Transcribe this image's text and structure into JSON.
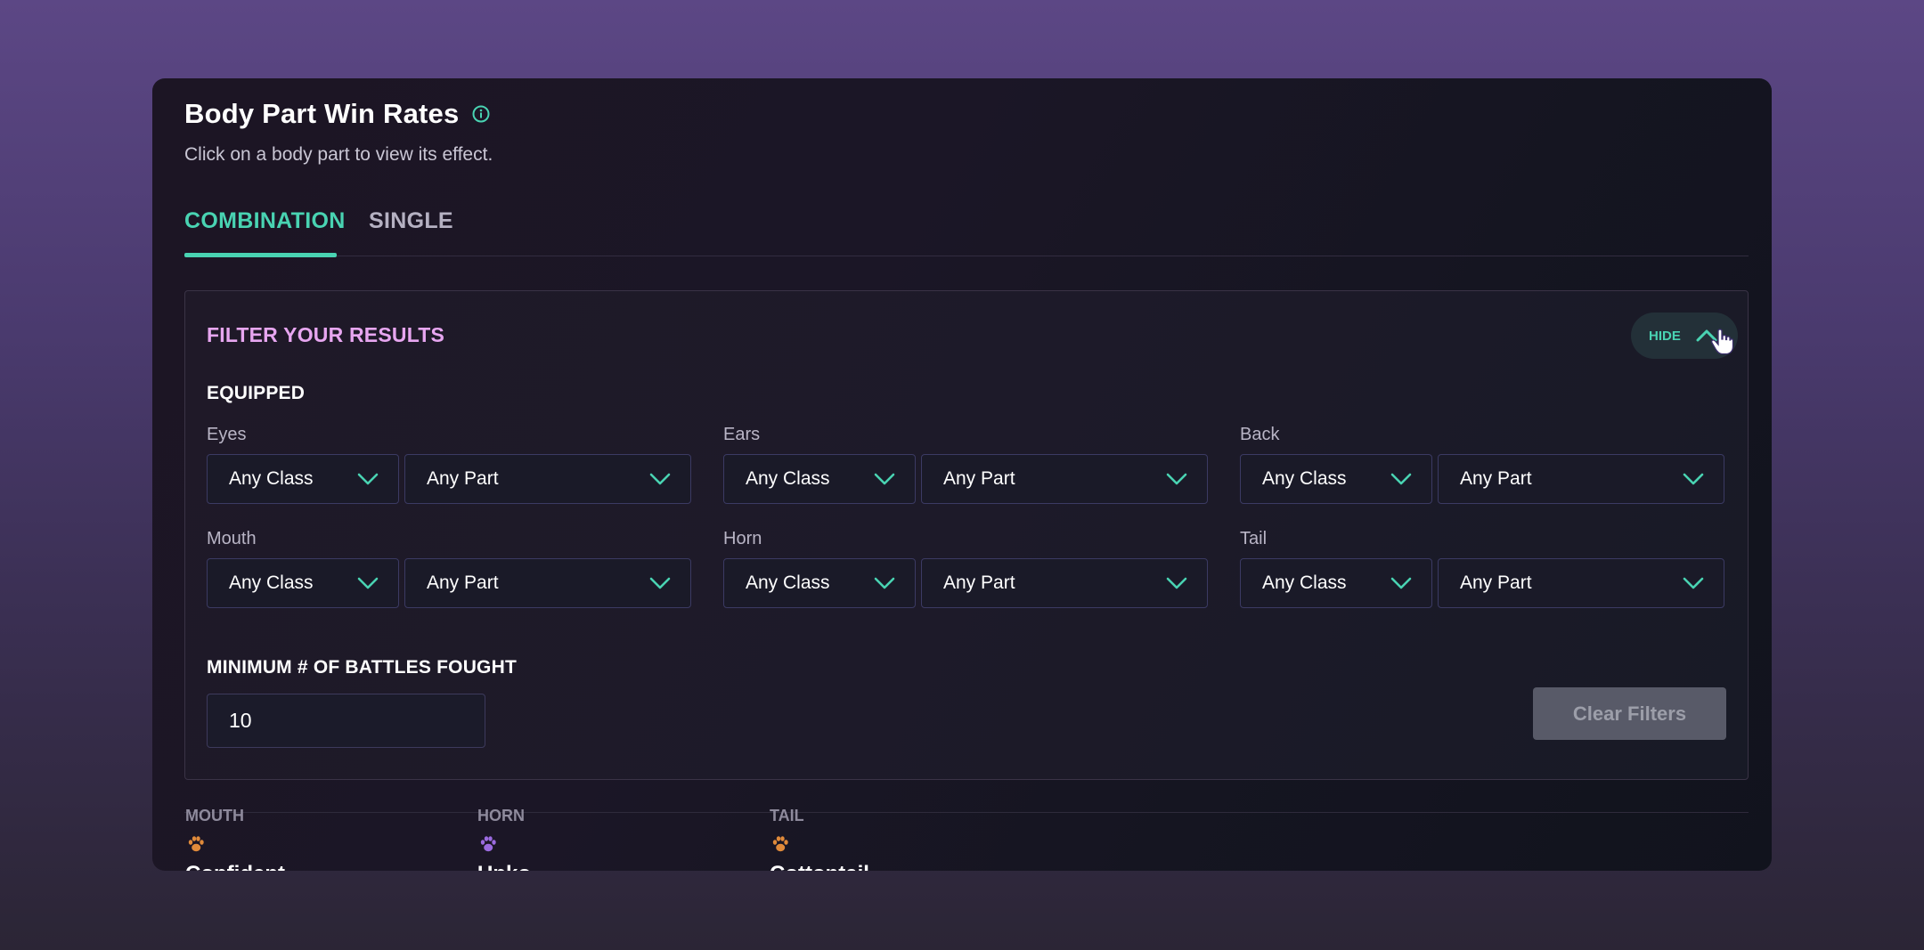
{
  "header": {
    "title": "Body Part Win Rates",
    "subtitle": "Click on a body part to view its effect."
  },
  "tabs": [
    {
      "label": "COMBINATION",
      "active": true
    },
    {
      "label": "SINGLE",
      "active": false
    }
  ],
  "filter": {
    "title": "FILTER YOUR RESULTS",
    "hide_label": "HIDE",
    "equipped_label": "EQUIPPED",
    "parts": [
      {
        "label": "Eyes",
        "class_value": "Any Class",
        "part_value": "Any Part"
      },
      {
        "label": "Ears",
        "class_value": "Any Class",
        "part_value": "Any Part"
      },
      {
        "label": "Back",
        "class_value": "Any Class",
        "part_value": "Any Part"
      },
      {
        "label": "Mouth",
        "class_value": "Any Class",
        "part_value": "Any Part"
      },
      {
        "label": "Horn",
        "class_value": "Any Class",
        "part_value": "Any Part"
      },
      {
        "label": "Tail",
        "class_value": "Any Class",
        "part_value": "Any Part"
      }
    ],
    "min_battles_label": "MINIMUM # OF BATTLES FOUGHT",
    "min_battles_value": "10",
    "clear_label": "Clear Filters"
  },
  "results": {
    "columns": [
      {
        "label": "MOUTH",
        "icon": "beast-class-paw-icon",
        "icon_color": "#e08a3a",
        "name": "Confident"
      },
      {
        "label": "HORN",
        "icon": "bug-class-paw-icon",
        "icon_color": "#9b6be0",
        "name": "Unko"
      },
      {
        "label": "TAIL",
        "icon": "beast-class-paw-icon",
        "icon_color": "#e08a3a",
        "name": "Cottontail"
      }
    ]
  },
  "colors": {
    "accent": "#49d3b2",
    "filter_title": "#e7a6f0",
    "panel_border": "#3a3346"
  }
}
